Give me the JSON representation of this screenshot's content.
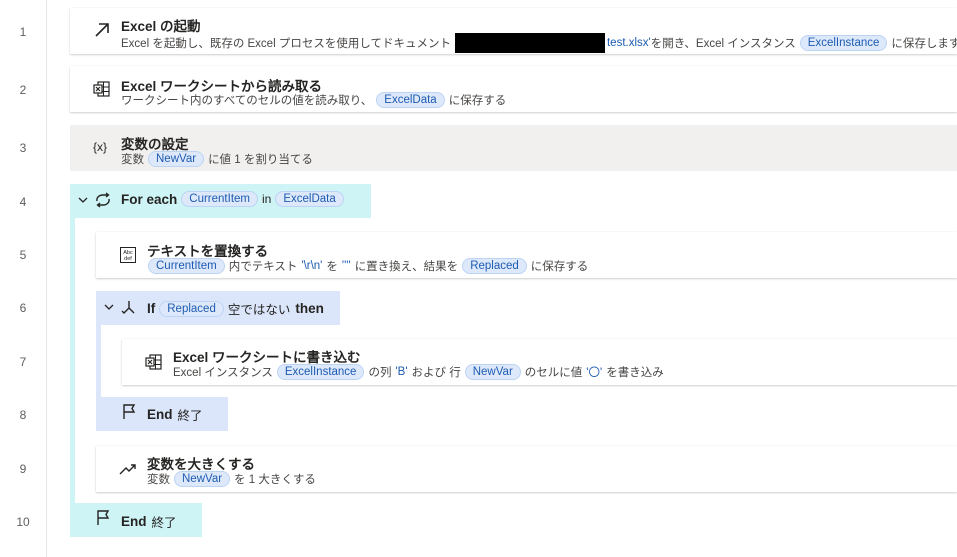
{
  "line_numbers": [
    "1",
    "2",
    "3",
    "4",
    "5",
    "6",
    "7",
    "8",
    "9",
    "10"
  ],
  "steps": {
    "s1": {
      "title": "Excel の起動",
      "desc_a": "Excel を起動し、既存の Excel プロセスを使用してドキュメント",
      "desc_file": "test.xlsx'",
      "desc_b": " を開き、Excel インスタンス",
      "var": "ExcelInstance",
      "desc_c": "に保存します。"
    },
    "s2": {
      "title": "Excel ワークシートから読み取る",
      "desc_a": "ワークシート内のすべてのセルの値を読み取り、",
      "var": "ExcelData",
      "desc_b": "に保存する"
    },
    "s3": {
      "title": "変数の設定",
      "desc_a": "変数",
      "var": "NewVar",
      "desc_b": "に値 1 を割り当てる"
    },
    "s4": {
      "keyword": "For each",
      "var": "CurrentItem",
      "in": "in",
      "var2": "ExcelData"
    },
    "s5": {
      "title": "テキストを置換する",
      "var": "CurrentItem",
      "desc_a": "内でテキスト",
      "lit1": "'\\r\\n'",
      "desc_b": "を",
      "lit2": "''''",
      "desc_c": "に置き換え、結果を",
      "var2": "Replaced",
      "desc_d": "に保存する"
    },
    "s6": {
      "keyword": "If",
      "var": "Replaced",
      "cond": "空ではない",
      "then": "then"
    },
    "s7": {
      "title": "Excel ワークシートに書き込む",
      "desc_a": "Excel インスタンス",
      "var": "ExcelInstance",
      "desc_b": "の列",
      "lit1": "'B'",
      "desc_c": "および 行",
      "var2": "NewVar",
      "desc_d": "のセルに値",
      "lit2": "'〇'",
      "desc_e": "を書き込み"
    },
    "s8": {
      "keyword": "End",
      "label": "終了"
    },
    "s9": {
      "title": "変数を大きくする",
      "desc_a": "変数",
      "var": "NewVar",
      "desc_b": "を 1 大きくする"
    },
    "s10": {
      "keyword": "End",
      "label": "終了"
    }
  },
  "colors": {
    "variable_pill_bg": "#dde9fb",
    "variable_text": "#1e5bb0",
    "loop_block_bg": "#cef4f5",
    "condition_block_bg": "#dbe6fb"
  }
}
